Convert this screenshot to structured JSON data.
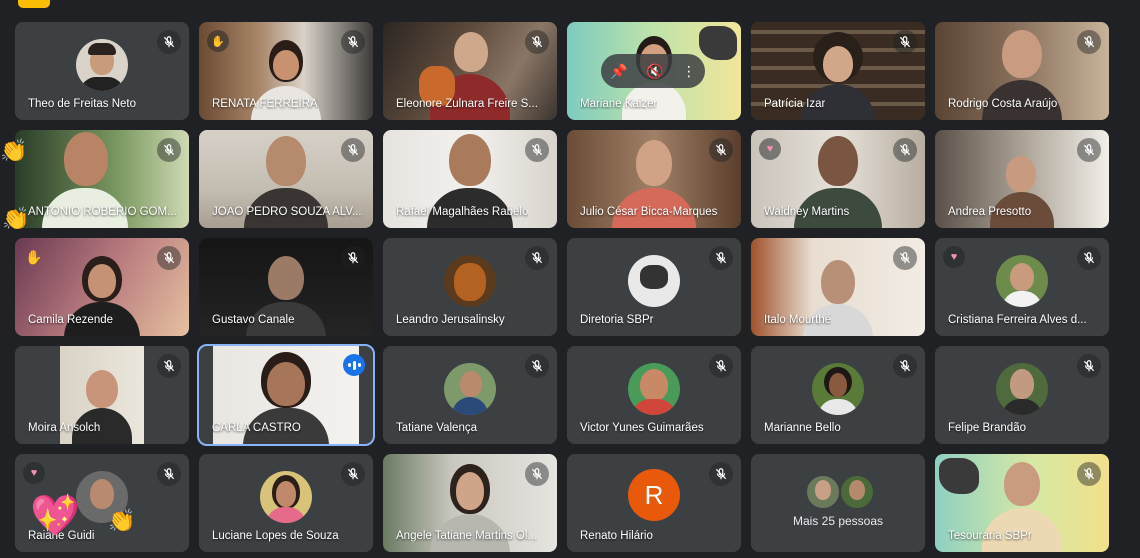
{
  "tiles": [
    {
      "name": "Theo de Freitas Neto"
    },
    {
      "name": "RENATA FERREIRA"
    },
    {
      "name": "Eleonore Zulnara Freire S..."
    },
    {
      "name": "Mariane Kaizer"
    },
    {
      "name": "Patrícia Izar"
    },
    {
      "name": "Rodrigo Costa Araújo"
    },
    {
      "name": "ANTONIO ROBERIO GOM..."
    },
    {
      "name": "JOÃO PEDRO SOUZA ALV..."
    },
    {
      "name": "Rafael Magalhães Rabelo"
    },
    {
      "name": "Julio César Bicca-Marques"
    },
    {
      "name": "Waldney Martins"
    },
    {
      "name": "Andrea Presotto"
    },
    {
      "name": "Camila Rezende"
    },
    {
      "name": "Gustavo Canale"
    },
    {
      "name": "Leandro Jerusalinsky"
    },
    {
      "name": "Diretoria SBPr"
    },
    {
      "name": "Ítalo Mourthé"
    },
    {
      "name": "Cristiana Ferreira Alves d..."
    },
    {
      "name": "Moira Ansolch"
    },
    {
      "name": "CARLA CASTRO"
    },
    {
      "name": "Tatiane Valença"
    },
    {
      "name": "Victor Yunes Guimarães"
    },
    {
      "name": "Marianne Bello"
    },
    {
      "name": "Felipe Brandão"
    },
    {
      "name": "Raiane Guidi"
    },
    {
      "name": "Luciane Lopes de Souza"
    },
    {
      "name": "Angele Tatiane Martins Ol..."
    },
    {
      "name": "Renato Hilário",
      "initial": "R"
    },
    {
      "name": "Mais 25 pessoas"
    },
    {
      "name": "Tesouraria SBPr"
    }
  ],
  "icons": {
    "mic_off": "mic-off-icon",
    "speaking": "audio-level-icon",
    "pin": "pin-icon",
    "mute": "mute-icon",
    "more": "more-options-icon",
    "heart": "heart-reaction-icon"
  },
  "colors": {
    "background": "#202124",
    "tile": "#3c4043",
    "active_border": "#8ab4f8",
    "speaking": "#1a73e8",
    "avatar_letter_bg": "#e8590c"
  }
}
